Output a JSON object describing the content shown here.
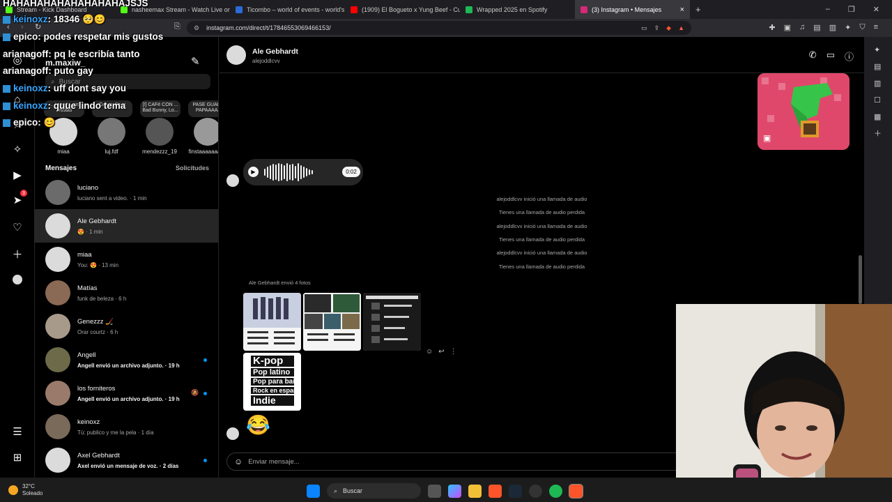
{
  "browser": {
    "tabs": [
      {
        "title": "Stream - Kick Dashboard",
        "color": "#53fc18"
      },
      {
        "title": "nasheemax Stream - Watch Live on K",
        "color": "#53fc18"
      },
      {
        "title": "Ticombo – world of events - world's l",
        "color": "#2a6bd9"
      },
      {
        "title": "(1909) El Bogueto x Yung Beef - Cua",
        "color": "#ff0000"
      },
      {
        "title": "Wrapped 2025 en Spotify",
        "color": "#1db954"
      },
      {
        "title": "(3) Instagram • Mensajes",
        "color": "#d62976"
      }
    ],
    "url": "instagram.com/direct/t/17846553069466153/"
  },
  "inbox": {
    "username": "m.maxiw_",
    "search_placeholder": "Buscar",
    "notes": [
      {
        "text": "... importa sus artistas",
        "name": "miaa",
        "color": "#d8d8d8"
      },
      {
        "text": "Conan Gray",
        "name": "luj.fdf",
        "color": "#777"
      },
      {
        "text": "[!] CAFé CON ... Bad Bunny, Lo...",
        "name": "mendezzz_19",
        "color": "#555"
      },
      {
        "text": "PASE GUARA PAPAAAAA",
        "name": "finstaaaaaaaaa",
        "color": "#999"
      }
    ],
    "section_title": "Mensajes",
    "requests_label": "Solicitudes",
    "conversations": [
      {
        "name": "luciano",
        "preview": "luciano sent a video. · 1 min",
        "unread": false,
        "color": "#6b6b6b"
      },
      {
        "name": "Ale Gebhardt",
        "preview": "😍 · 1 min",
        "unread": false,
        "color": "#dbdbdb"
      },
      {
        "name": "miaa",
        "preview": "You: 😍 · 13 min",
        "unread": false,
        "color": "#dbdbdb"
      },
      {
        "name": "Matías",
        "preview": "funk de beleza · 6 h",
        "unread": false,
        "color": "#8a6a55"
      },
      {
        "name": "Genezzz 🏒",
        "preview": "Orar courtz · 6 h",
        "unread": false,
        "color": "#a89a8a"
      },
      {
        "name": "Angell",
        "preview": "Angell envió un archivo adjunto. · 19 h",
        "unread": true,
        "color": "#6d6a4a"
      },
      {
        "name": "los forniteros",
        "preview": "Angell envió un archivo adjunto. · 19 h",
        "unread": true,
        "color": "#9a7a6a"
      },
      {
        "name": "keinoxz",
        "preview": "Tú: publico y me la pela · 1 día",
        "unread": false,
        "color": "#7a6a5a"
      },
      {
        "name": "Axel Gebhardt",
        "preview": "Axel envió un mensaje de voz. · 2 días",
        "unread": true,
        "color": "#dbdbdb"
      }
    ]
  },
  "chat": {
    "name": "Ale Gebhardt",
    "handle": "alejoddlcvv",
    "voice_duration": "0:02",
    "system_messages": [
      "alejoddlcvv inició una llamada de audio",
      "Tienes una llamada de audio perdida",
      "alejoddlcvv inició una llamada de audio",
      "Tienes una llamada de audio perdida",
      "alejoddlcvv inició una llamada de audio",
      "Tienes una llamada de audio perdida"
    ],
    "photos_caption": "Ale Gebhardt envió 4 fotos",
    "photo4_lines": [
      "K-pop",
      "Pop latino",
      "Pop para bailar",
      "Rock en español",
      "Indie"
    ],
    "emoji": "😂",
    "composer_placeholder": "Enviar mensaje..."
  },
  "overlay": {
    "lines": [
      {
        "user": "",
        "text": "HAHAHAHAHAHAHAHAHAJSJS",
        "icon": false,
        "blue": false
      },
      {
        "user": "keinoxz",
        "text": ": 18346 🥺😊",
        "icon": true,
        "blue": true
      },
      {
        "user": "epico",
        "text": ": podes respetar mis gustos",
        "icon": true,
        "blue": false
      },
      {
        "user": "arianagoff",
        "text": ": pq le escribía tanto",
        "icon": false,
        "blue": false
      },
      {
        "user": "arianagoff",
        "text": ": puto gay",
        "icon": false,
        "blue": false
      },
      {
        "user": "keinoxz",
        "text": ": uff dont say you",
        "icon": true,
        "blue": true
      },
      {
        "user": "keinoxz",
        "text": ": quue lindo tema",
        "icon": true,
        "blue": true
      },
      {
        "user": "epico",
        "text": ": 😊",
        "icon": true,
        "blue": false
      }
    ]
  },
  "taskbar": {
    "temperature": "32°C",
    "weather": "Soleado",
    "search_label": "Buscar"
  },
  "nav_badge": "3"
}
